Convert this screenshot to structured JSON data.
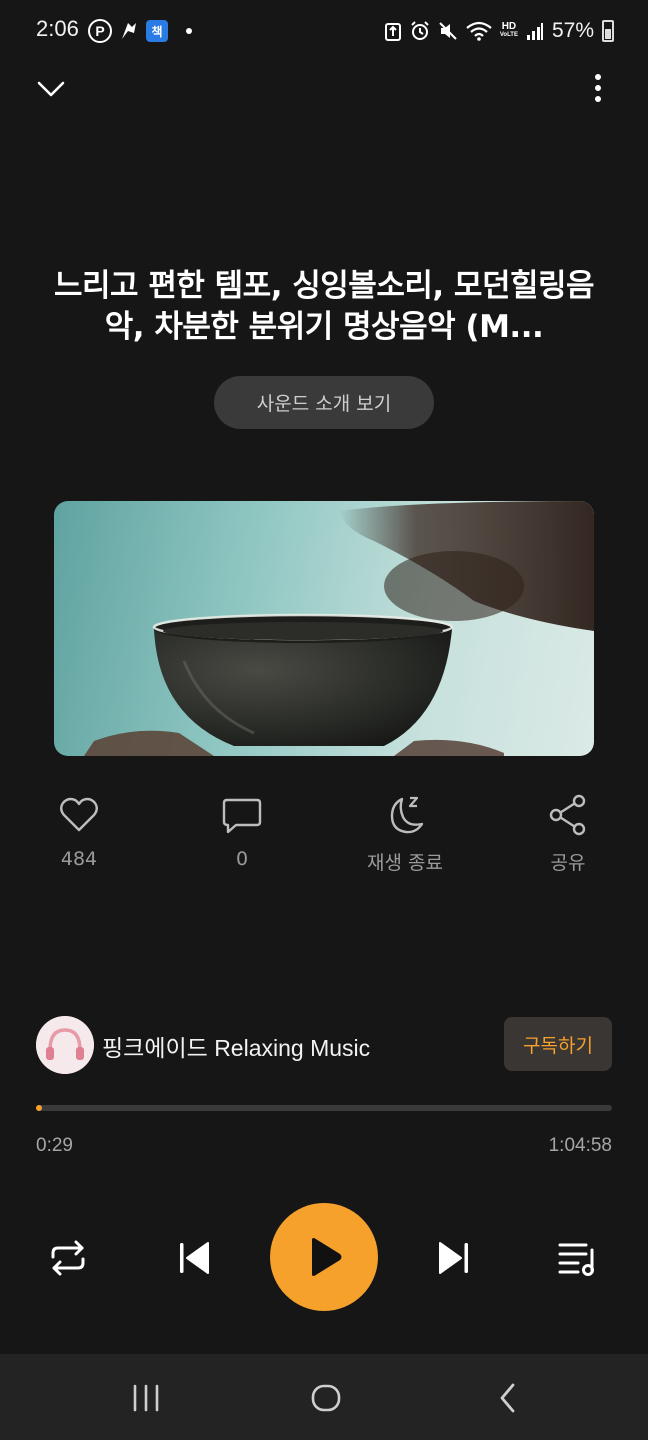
{
  "status_bar": {
    "time": "2:06",
    "battery": "57%",
    "hd_label": "HD",
    "voice_label": "VoLTE",
    "icons": [
      "p-icon",
      "app-icon",
      "news-app-icon",
      "dot-icon",
      "recycle-icon",
      "alarm-icon",
      "mute-icon",
      "wifi-icon",
      "signal-icon",
      "battery-icon"
    ]
  },
  "header": {
    "collapse_icon": "chevron-down-icon",
    "more_icon": "more-vertical-icon"
  },
  "track": {
    "title": "느리고 편한 템포, 싱잉볼소리, 모던힐링음악, 차분한 분위기 명상음악 (M...",
    "sound_intro_label": "사운드 소개 보기"
  },
  "actions": {
    "like_count": "484",
    "comment_count": "0",
    "sleep_timer_label": "재생 종료",
    "share_label": "공유"
  },
  "channel": {
    "name": "핑크에이드 Relaxing Music",
    "subscribe_label": "구독하기"
  },
  "playback": {
    "current_time": "0:29",
    "total_time": "1:04:58",
    "progress_fraction": 0.0074
  },
  "colors": {
    "accent": "#f5a12c",
    "background": "#161616"
  }
}
